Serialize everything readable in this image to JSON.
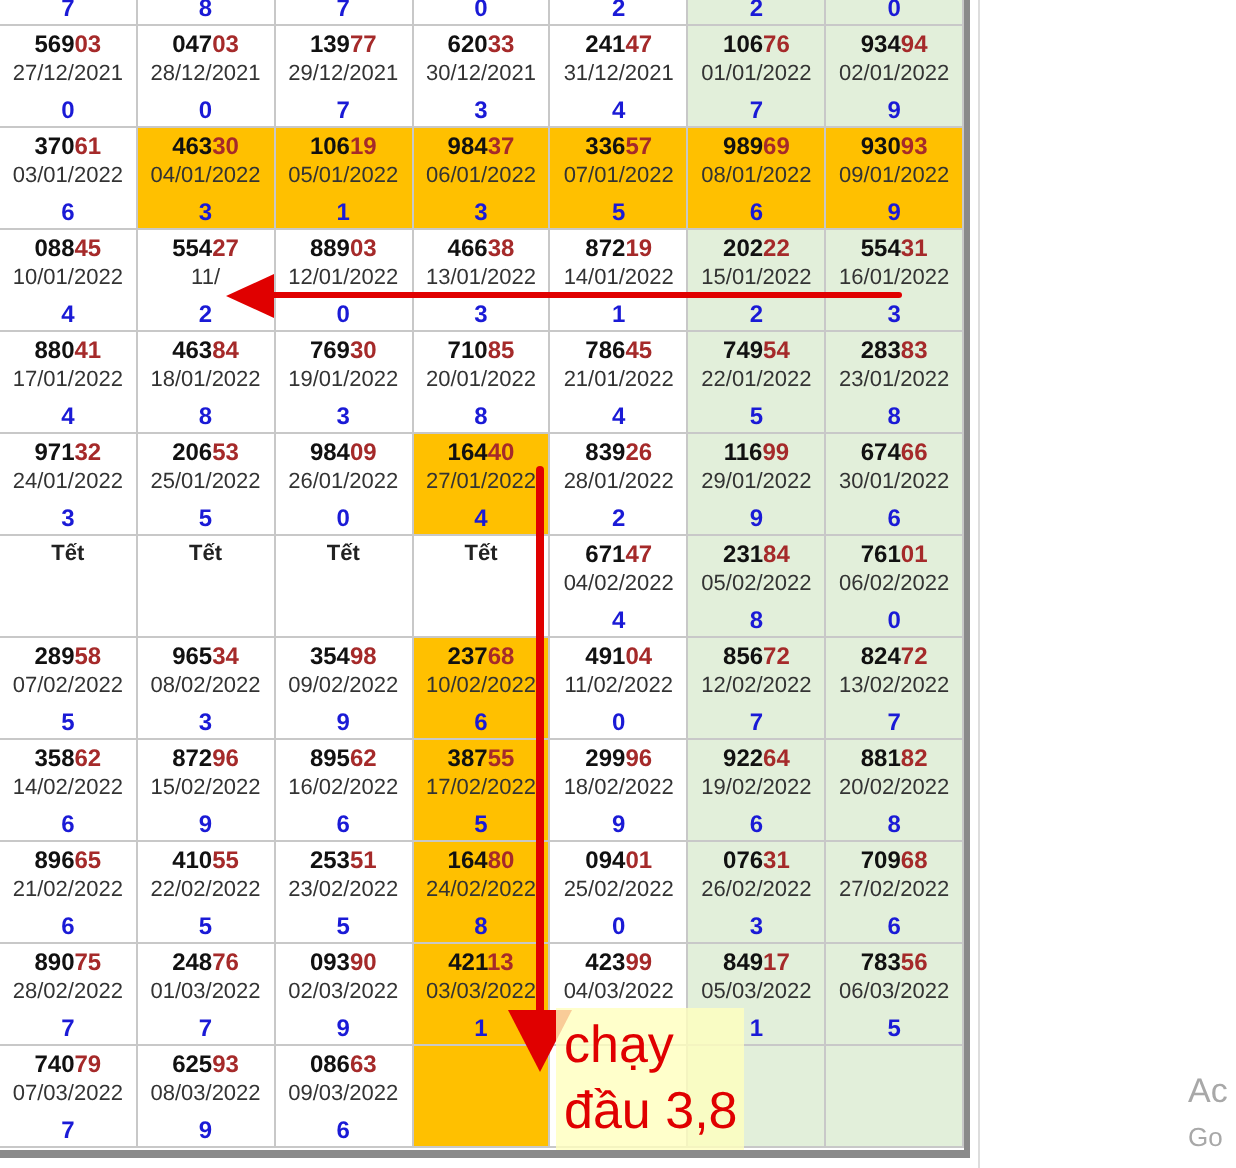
{
  "columns": [
    {
      "shaded": false
    },
    {
      "shaded": false
    },
    {
      "shaded": false
    },
    {
      "shaded": false
    },
    {
      "shaded": false
    },
    {
      "shaded": true
    },
    {
      "shaded": true
    }
  ],
  "rows": [
    [
      {
        "digit": "7",
        "highlighted": false
      },
      {
        "digit": "8",
        "highlighted": false
      },
      {
        "digit": "7",
        "highlighted": false
      },
      {
        "digit": "0",
        "highlighted": false
      },
      {
        "digit": "2",
        "highlighted": false
      },
      {
        "digit": "2",
        "highlighted": false
      },
      {
        "digit": "0",
        "highlighted": false
      }
    ],
    [
      {
        "number": "56903",
        "date": "27/12/2021",
        "digit": "0",
        "highlighted": false
      },
      {
        "number": "04703",
        "date": "28/12/2021",
        "digit": "0",
        "highlighted": false
      },
      {
        "number": "13977",
        "date": "29/12/2021",
        "digit": "7",
        "highlighted": false
      },
      {
        "number": "62033",
        "date": "30/12/2021",
        "digit": "3",
        "highlighted": false
      },
      {
        "number": "24147",
        "date": "31/12/2021",
        "digit": "4",
        "highlighted": false
      },
      {
        "number": "10676",
        "date": "01/01/2022",
        "digit": "7",
        "highlighted": false
      },
      {
        "number": "93494",
        "date": "02/01/2022",
        "digit": "9",
        "highlighted": false
      }
    ],
    [
      {
        "number": "37061",
        "date": "03/01/2022",
        "digit": "6",
        "highlighted": false
      },
      {
        "number": "46330",
        "date": "04/01/2022",
        "digit": "3",
        "highlighted": true
      },
      {
        "number": "10619",
        "date": "05/01/2022",
        "digit": "1",
        "highlighted": true
      },
      {
        "number": "98437",
        "date": "06/01/2022",
        "digit": "3",
        "highlighted": true
      },
      {
        "number": "33657",
        "date": "07/01/2022",
        "digit": "5",
        "highlighted": true
      },
      {
        "number": "98969",
        "date": "08/01/2022",
        "digit": "6",
        "highlighted": true
      },
      {
        "number": "93093",
        "date": "09/01/2022",
        "digit": "9",
        "highlighted": true
      }
    ],
    [
      {
        "number": "08845",
        "date": "10/01/2022",
        "digit": "4",
        "highlighted": false
      },
      {
        "number": "55427",
        "date": "11/",
        "digit": "2",
        "highlighted": false
      },
      {
        "number": "88903",
        "date": "12/01/2022",
        "digit": "0",
        "highlighted": false
      },
      {
        "number": "46638",
        "date": "13/01/2022",
        "digit": "3",
        "highlighted": false
      },
      {
        "number": "87219",
        "date": "14/01/2022",
        "digit": "1",
        "highlighted": false
      },
      {
        "number": "20222",
        "date": "15/01/2022",
        "digit": "2",
        "highlighted": false
      },
      {
        "number": "55431",
        "date": "16/01/2022",
        "digit": "3",
        "highlighted": false
      }
    ],
    [
      {
        "number": "88041",
        "date": "17/01/2022",
        "digit": "4",
        "highlighted": false
      },
      {
        "number": "46384",
        "date": "18/01/2022",
        "digit": "8",
        "highlighted": false
      },
      {
        "number": "76930",
        "date": "19/01/2022",
        "digit": "3",
        "highlighted": false
      },
      {
        "number": "71085",
        "date": "20/01/2022",
        "digit": "8",
        "highlighted": false
      },
      {
        "number": "78645",
        "date": "21/01/2022",
        "digit": "4",
        "highlighted": false
      },
      {
        "number": "74954",
        "date": "22/01/2022",
        "digit": "5",
        "highlighted": false
      },
      {
        "number": "28383",
        "date": "23/01/2022",
        "digit": "8",
        "highlighted": false
      }
    ],
    [
      {
        "number": "97132",
        "date": "24/01/2022",
        "digit": "3",
        "highlighted": false
      },
      {
        "number": "20653",
        "date": "25/01/2022",
        "digit": "5",
        "highlighted": false
      },
      {
        "number": "98409",
        "date": "26/01/2022",
        "digit": "0",
        "highlighted": false
      },
      {
        "number": "16440",
        "date": "27/01/2022",
        "digit": "4",
        "highlighted": true
      },
      {
        "number": "83926",
        "date": "28/01/2022",
        "digit": "2",
        "highlighted": false
      },
      {
        "number": "11699",
        "date": "29/01/2022",
        "digit": "9",
        "highlighted": false
      },
      {
        "number": "67466",
        "date": "30/01/2022",
        "digit": "6",
        "highlighted": false
      }
    ],
    [
      {
        "holiday": "Tết",
        "highlighted": false
      },
      {
        "holiday": "Tết",
        "highlighted": false
      },
      {
        "holiday": "Tết",
        "highlighted": false
      },
      {
        "holiday": "Tết",
        "highlighted": false
      },
      {
        "number": "67147",
        "date": "04/02/2022",
        "digit": "4",
        "highlighted": false
      },
      {
        "number": "23184",
        "date": "05/02/2022",
        "digit": "8",
        "highlighted": false
      },
      {
        "number": "76101",
        "date": "06/02/2022",
        "digit": "0",
        "highlighted": false
      }
    ],
    [
      {
        "number": "28958",
        "date": "07/02/2022",
        "digit": "5",
        "highlighted": false
      },
      {
        "number": "96534",
        "date": "08/02/2022",
        "digit": "3",
        "highlighted": false
      },
      {
        "number": "35498",
        "date": "09/02/2022",
        "digit": "9",
        "highlighted": false
      },
      {
        "number": "23768",
        "date": "10/02/2022",
        "digit": "6",
        "highlighted": true
      },
      {
        "number": "49104",
        "date": "11/02/2022",
        "digit": "0",
        "highlighted": false
      },
      {
        "number": "85672",
        "date": "12/02/2022",
        "digit": "7",
        "highlighted": false
      },
      {
        "number": "82472",
        "date": "13/02/2022",
        "digit": "7",
        "highlighted": false
      }
    ],
    [
      {
        "number": "35862",
        "date": "14/02/2022",
        "digit": "6",
        "highlighted": false
      },
      {
        "number": "87296",
        "date": "15/02/2022",
        "digit": "9",
        "highlighted": false
      },
      {
        "number": "89562",
        "date": "16/02/2022",
        "digit": "6",
        "highlighted": false
      },
      {
        "number": "38755",
        "date": "17/02/2022",
        "digit": "5",
        "highlighted": true
      },
      {
        "number": "29996",
        "date": "18/02/2022",
        "digit": "9",
        "highlighted": false
      },
      {
        "number": "92264",
        "date": "19/02/2022",
        "digit": "6",
        "highlighted": false
      },
      {
        "number": "88182",
        "date": "20/02/2022",
        "digit": "8",
        "highlighted": false
      }
    ],
    [
      {
        "number": "89665",
        "date": "21/02/2022",
        "digit": "6",
        "highlighted": false
      },
      {
        "number": "41055",
        "date": "22/02/2022",
        "digit": "5",
        "highlighted": false
      },
      {
        "number": "25351",
        "date": "23/02/2022",
        "digit": "5",
        "highlighted": false
      },
      {
        "number": "16480",
        "date": "24/02/2022",
        "digit": "8",
        "highlighted": true
      },
      {
        "number": "09401",
        "date": "25/02/2022",
        "digit": "0",
        "highlighted": false
      },
      {
        "number": "07631",
        "date": "26/02/2022",
        "digit": "3",
        "highlighted": false
      },
      {
        "number": "70968",
        "date": "27/02/2022",
        "digit": "6",
        "highlighted": false
      }
    ],
    [
      {
        "number": "89075",
        "date": "28/02/2022",
        "digit": "7",
        "highlighted": false
      },
      {
        "number": "24876",
        "date": "01/03/2022",
        "digit": "7",
        "highlighted": false
      },
      {
        "number": "09390",
        "date": "02/03/2022",
        "digit": "9",
        "highlighted": false
      },
      {
        "number": "42113",
        "date": "03/03/2022",
        "digit": "1",
        "highlighted": true
      },
      {
        "number": "42399",
        "date": "04/03/2022",
        "highlighted": false
      },
      {
        "number": "84917",
        "date": "05/03/2022",
        "digit": "1",
        "highlighted": false
      },
      {
        "number": "78356",
        "date": "06/03/2022",
        "digit": "5",
        "highlighted": false
      }
    ],
    [
      {
        "number": "74079",
        "date": "07/03/2022",
        "digit": "7",
        "highlighted": false
      },
      {
        "number": "62593",
        "date": "08/03/2022",
        "digit": "9",
        "highlighted": false
      },
      {
        "number": "08663",
        "date": "09/03/2022",
        "digit": "6",
        "highlighted": false
      },
      {
        "highlighted": true
      },
      {
        "highlighted": false
      },
      {
        "highlighted": false
      },
      {
        "highlighted": false
      }
    ]
  ],
  "annotation": {
    "text": "chạy đầu 3,8"
  },
  "os_notice": {
    "line_1": "Ac",
    "line_2": "Go"
  }
}
